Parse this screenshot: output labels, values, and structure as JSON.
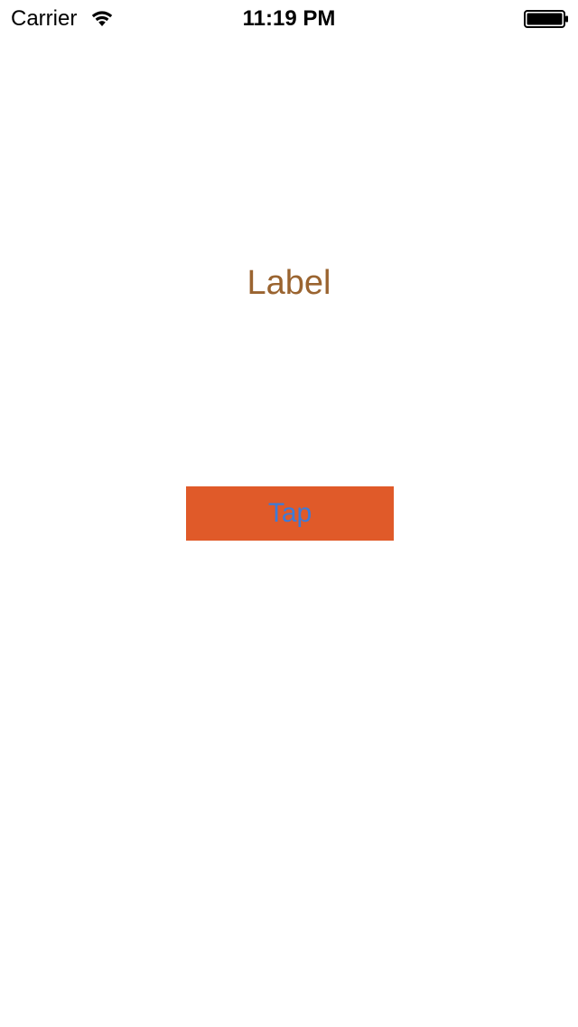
{
  "status_bar": {
    "carrier": "Carrier",
    "time": "11:19 PM",
    "wifi_icon": "wifi-icon",
    "battery_icon": "battery-icon"
  },
  "main": {
    "label_text": "Label",
    "label_color": "#9a6430",
    "button": {
      "label": "Tap",
      "background": "#e05a29",
      "text_color": "#3d7bd8"
    }
  }
}
